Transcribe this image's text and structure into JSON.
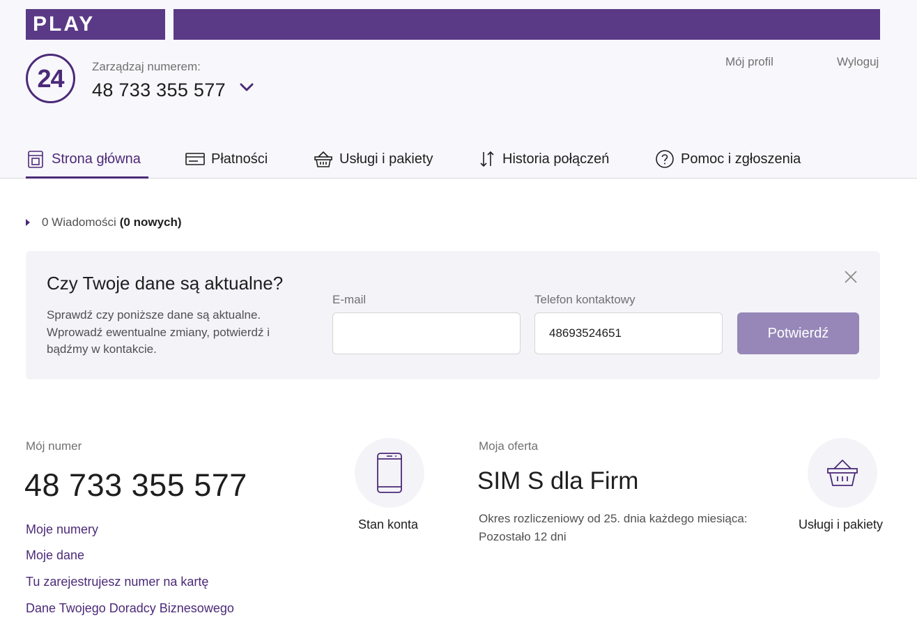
{
  "header": {
    "logo_text": "PLAY",
    "badge": "24",
    "manage_label": "Zarządzaj numerem:",
    "manage_number": "48 733 355 577",
    "profile_link": "Mój profil",
    "logout_link": "Wyloguj",
    "brand_color": "#5a3a86"
  },
  "nav": {
    "items": [
      {
        "label": "Strona główna",
        "icon": "home-icon",
        "active": true
      },
      {
        "label": "Płatności",
        "icon": "card-icon"
      },
      {
        "label": "Usługi i pakiety",
        "icon": "basket-icon"
      },
      {
        "label": "Historia połączeń",
        "icon": "arrows-updown-icon"
      },
      {
        "label": "Pomoc i zgłoszenia",
        "icon": "help-icon"
      }
    ]
  },
  "messages": {
    "text": "0 Wiadomości",
    "new_text": "(0 nowych)"
  },
  "data_check": {
    "title": "Czy Twoje dane są aktualne?",
    "description": "Sprawdź czy poniższe dane są aktualne. Wprowadź ewentualne zmiany, potwierdź i bądźmy w kontakcie.",
    "email_label": "E-mail",
    "email_value": "",
    "phone_label": "Telefon kontaktowy",
    "phone_value": "48693524651",
    "confirm_button": "Potwierdź"
  },
  "my_number": {
    "label": "Mój numer",
    "number": "48 733 355 577",
    "links": [
      "Moje numery",
      "Moje dane",
      "Tu zarejestrujesz numer na kartę",
      "Dane Twojego Doradcy Biznesowego"
    ]
  },
  "balance_tile": {
    "label": "Stan konta",
    "icon": "phone-icon"
  },
  "offer": {
    "label": "Moja oferta",
    "name": "SIM S dla Firm",
    "period_line1": "Okres rozliczeniowy od 25. dnia każdego miesiąca:",
    "period_line2": "Pozostało 12 dni"
  },
  "services_tile": {
    "label": "Usługi i pakiety",
    "icon": "basket-icon"
  }
}
